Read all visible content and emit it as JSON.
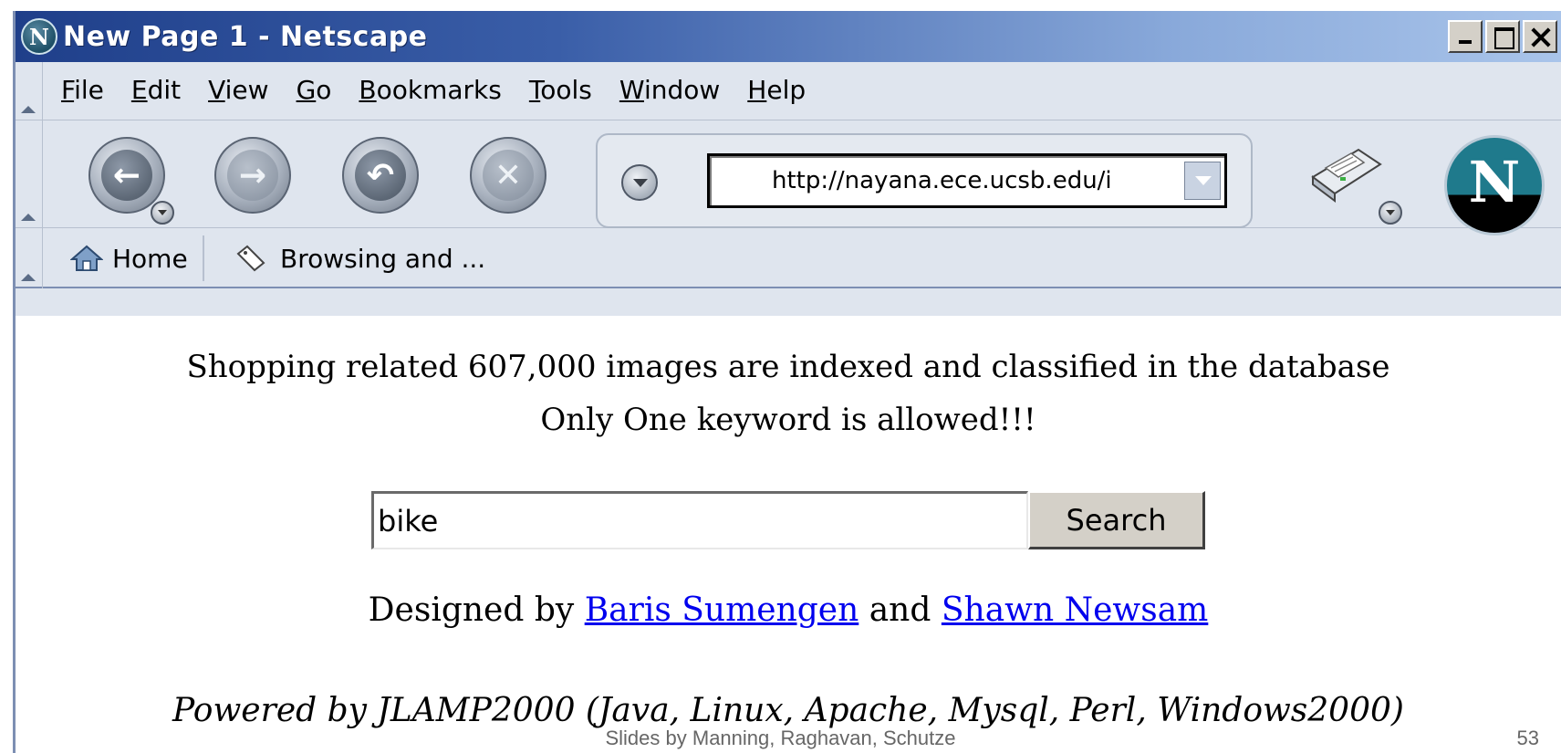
{
  "window": {
    "title": "New Page 1 - Netscape",
    "app_icon_letter": "N"
  },
  "menu": [
    {
      "label": "File",
      "accel": "F",
      "rest": "ile"
    },
    {
      "label": "Edit",
      "accel": "E",
      "rest": "dit"
    },
    {
      "label": "View",
      "accel": "V",
      "rest": "iew"
    },
    {
      "label": "Go",
      "accel": "G",
      "rest": "o"
    },
    {
      "label": "Bookmarks",
      "accel": "B",
      "rest": "ookmarks"
    },
    {
      "label": "Tools",
      "accel": "T",
      "rest": "ools"
    },
    {
      "label": "Window",
      "accel": "W",
      "rest": "indow"
    },
    {
      "label": "Help",
      "accel": "H",
      "rest": "elp"
    }
  ],
  "navigation": {
    "url": "http://nayana.ece.ucsb.edu/i",
    "logo_letter": "N"
  },
  "personal_toolbar": {
    "home_label": "Home",
    "bookmark_label": "Browsing and ..."
  },
  "page": {
    "line1": "Shopping related 607,000 images are indexed and classified in the database",
    "line2": "Only One keyword is allowed!!!",
    "search_value": "bike",
    "search_button": "Search",
    "designed_prefix": "Designed by ",
    "designer1": "Baris Sumengen",
    "designed_and": " and ",
    "designer2": "Shawn Newsam",
    "powered": "Powered by JLAMP2000 (Java, Linux, Apache, Mysql, Perl, Windows2000)"
  },
  "slide": {
    "caption": "Slides by Manning, Raghavan, Schutze",
    "page_number": "53"
  },
  "icons": {
    "back": "back-arrow-icon",
    "forward": "forward-arrow-icon",
    "reload": "reload-icon",
    "stop": "stop-icon",
    "print": "print-icon",
    "home": "home-icon",
    "bookmark": "bookmark-icon"
  },
  "colors": {
    "titlebar_start": "#1f3f8a",
    "titlebar_end": "#a9c4ea",
    "chrome_bg": "#dfe5ee",
    "link": "#0000ee"
  }
}
